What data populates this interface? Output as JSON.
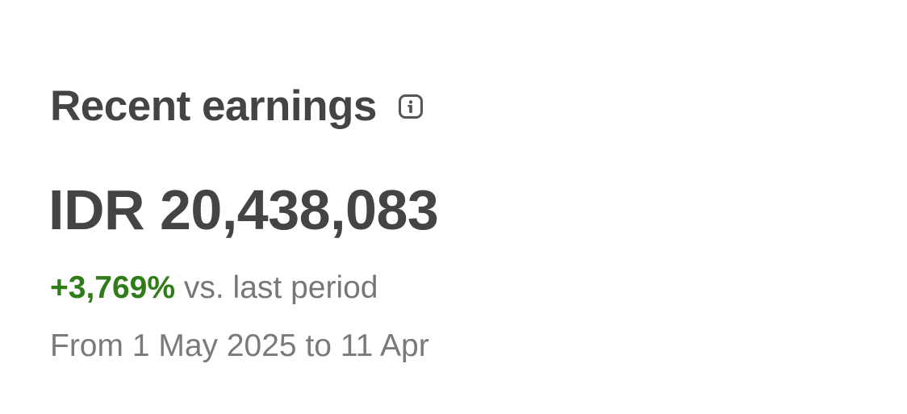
{
  "earnings": {
    "title": "Recent earnings",
    "info_icon": "info-icon",
    "amount": "IDR 20,438,083",
    "change_value": "+3,769%",
    "change_label": "vs. last period",
    "date_range": "From 1 May 2025 to 11 Apr"
  },
  "colors": {
    "text_primary": "#444444",
    "text_secondary": "#777777",
    "positive": "#2f7d18",
    "background": "#ffffff"
  }
}
